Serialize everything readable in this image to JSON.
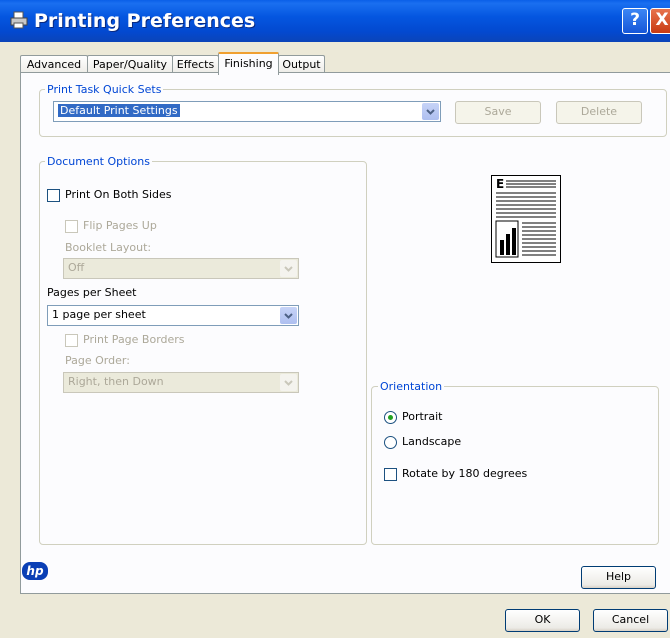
{
  "window": {
    "title": "Printing Preferences",
    "help_glyph": "?",
    "close_glyph": "X"
  },
  "tabs": [
    {
      "label": "Advanced"
    },
    {
      "label": "Paper/Quality"
    },
    {
      "label": "Effects"
    },
    {
      "label": "Finishing",
      "active": true
    },
    {
      "label": "Output"
    }
  ],
  "quick_sets": {
    "legend": "Print Task Quick Sets",
    "value": "Default Print Settings",
    "save_label": "Save",
    "delete_label": "Delete"
  },
  "document_options": {
    "legend": "Document Options",
    "both_sides_label": "Print On Both Sides",
    "flip_pages_label": "Flip Pages Up",
    "booklet_label": "Booklet Layout:",
    "booklet_value": "Off",
    "pages_per_sheet_label": "Pages per Sheet",
    "pages_per_sheet_value": "1 page per sheet",
    "page_borders_label": "Print Page Borders",
    "page_order_label": "Page Order:",
    "page_order_value": "Right, then Down"
  },
  "orientation": {
    "legend": "Orientation",
    "portrait_label": "Portrait",
    "landscape_label": "Landscape",
    "rotate_label": "Rotate by 180 degrees",
    "selected": "Portrait"
  },
  "footer": {
    "logo_text": "hp",
    "help_label": "Help",
    "ok_label": "OK",
    "cancel_label": "Cancel"
  },
  "colors": {
    "accent": "#0046d5",
    "titlebar": "#0456e0"
  },
  "icons": [
    "printer-icon",
    "help-icon",
    "close-icon",
    "chevron-down-icon",
    "hp-logo-icon"
  ]
}
